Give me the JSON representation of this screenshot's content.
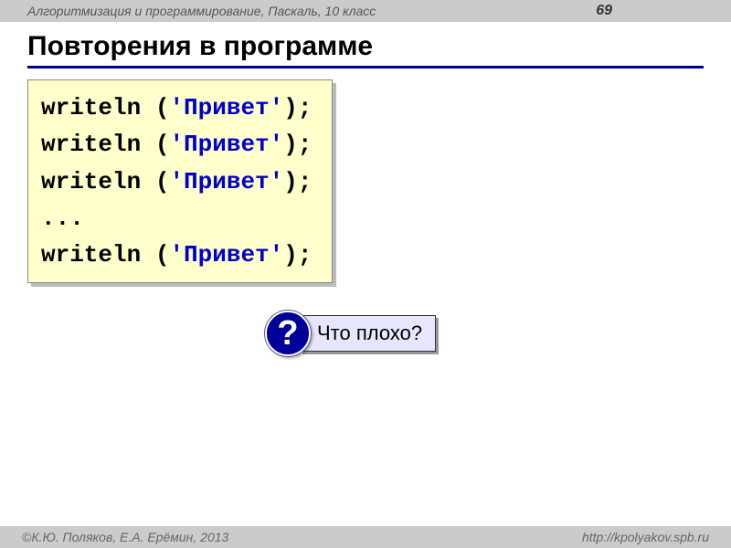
{
  "header": {
    "course": "Алгоритмизация и программирование, Паскаль, 10 класс",
    "page": "69"
  },
  "title": "Повторения в программе",
  "code": {
    "lines": [
      {
        "prefix": "writeln (",
        "string": "'Привет'",
        "suffix": ");"
      },
      {
        "prefix": "writeln (",
        "string": "'Привет'",
        "suffix": ");"
      },
      {
        "prefix": "writeln (",
        "string": "'Привет'",
        "suffix": ");"
      },
      {
        "prefix": "...",
        "string": "",
        "suffix": ""
      },
      {
        "prefix": "writeln (",
        "string": "'Привет'",
        "suffix": ");"
      }
    ]
  },
  "question": {
    "mark": "?",
    "text": "Что плохо?"
  },
  "footer": {
    "copyright": "©К.Ю. Поляков, Е.А. Ерёмин, 2013",
    "url": "http://kpolyakov.spb.ru"
  }
}
